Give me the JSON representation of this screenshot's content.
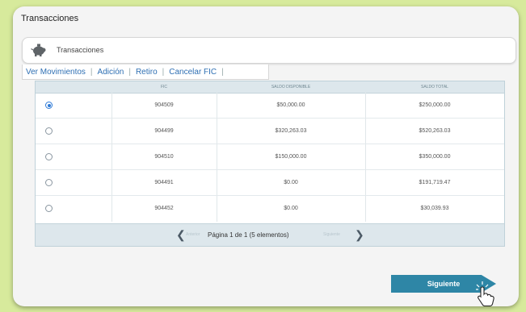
{
  "window": {
    "title": "Transacciones"
  },
  "panel": {
    "label": "Transacciones",
    "icon": "piggy-bank-icon"
  },
  "tabs": [
    {
      "label": "Ver Movimientos"
    },
    {
      "label": "Adición"
    },
    {
      "label": "Retiro"
    },
    {
      "label": "Cancelar FIC"
    }
  ],
  "table": {
    "columns": [
      "FIC",
      "SALDO DISPONIBLE",
      "SALDO TOTAL"
    ],
    "rows": [
      {
        "selected": true,
        "fic": "904509",
        "disponible": "$50,000.00",
        "total": "$250,000.00"
      },
      {
        "selected": false,
        "fic": "904499",
        "disponible": "$320,263.03",
        "total": "$520,263.03"
      },
      {
        "selected": false,
        "fic": "904510",
        "disponible": "$150,000.00",
        "total": "$350,000.00"
      },
      {
        "selected": false,
        "fic": "904491",
        "disponible": "$0.00",
        "total": "$191,719.47"
      },
      {
        "selected": false,
        "fic": "904452",
        "disponible": "$0.00",
        "total": "$30,039.93"
      }
    ]
  },
  "pager": {
    "prev": "Anterior",
    "info": "Página 1 de 1 (5 elementos)",
    "next": "Siguiente"
  },
  "next_button": {
    "label": "Siguiente"
  },
  "colors": {
    "accent": "#2e86a6",
    "link": "#2e6fb3",
    "background": "#d7ea9c"
  }
}
